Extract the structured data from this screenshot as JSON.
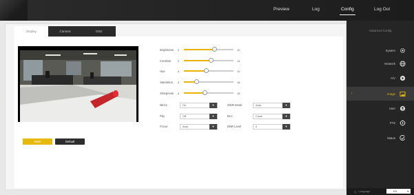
{
  "nav": {
    "items": [
      {
        "label": "Preview",
        "active": false
      },
      {
        "label": "Log",
        "active": false
      },
      {
        "label": "Config",
        "active": true
      },
      {
        "label": "Log Out",
        "active": false
      }
    ]
  },
  "tabs": [
    {
      "label": "Display",
      "active": true
    },
    {
      "label": "Camera",
      "active": false
    },
    {
      "label": "OSD",
      "active": false
    }
  ],
  "sliders": [
    {
      "label": "Brightness",
      "min": "0",
      "max": "10",
      "fraction": 0.62
    },
    {
      "label": "Contrast",
      "min": "0",
      "max": "14",
      "fraction": 0.55
    },
    {
      "label": "Hue",
      "min": "0",
      "max": "10",
      "fraction": 0.45
    },
    {
      "label": "Saturation",
      "min": "0",
      "max": "15",
      "fraction": 0.25
    },
    {
      "label": "Sharpness",
      "min": "0",
      "max": "15",
      "fraction": 0.42
    }
  ],
  "selects": {
    "left": [
      {
        "label": "Mirror",
        "value": "On"
      },
      {
        "label": "Flip",
        "value": "Off"
      },
      {
        "label": "Focus",
        "value": "Auto"
      }
    ],
    "right": [
      {
        "label": "WDR Mode",
        "value": "Auto"
      },
      {
        "label": "BLC",
        "value": "Close"
      },
      {
        "label": "DNR Level",
        "value": "0"
      }
    ]
  },
  "buttons": {
    "save": "Save",
    "default": "Default"
  },
  "sidebar": {
    "title": "Advanced Config",
    "items": [
      {
        "label": "System",
        "icon": "gear-icon",
        "active": false
      },
      {
        "label": "Network",
        "icon": "globe-icon",
        "active": false
      },
      {
        "label": "A/V",
        "icon": "av-icon",
        "active": false
      },
      {
        "label": "Image",
        "icon": "image-icon",
        "active": true
      },
      {
        "label": "User",
        "icon": "user-icon",
        "active": false
      },
      {
        "label": "PTZ",
        "icon": "ptz-icon",
        "active": false
      },
      {
        "label": "Status",
        "icon": "status-icon",
        "active": false
      }
    ],
    "footer": {
      "label": "Language",
      "value": "EN"
    }
  },
  "colors": {
    "accent": "#e5b90d",
    "dark": "#252525"
  }
}
